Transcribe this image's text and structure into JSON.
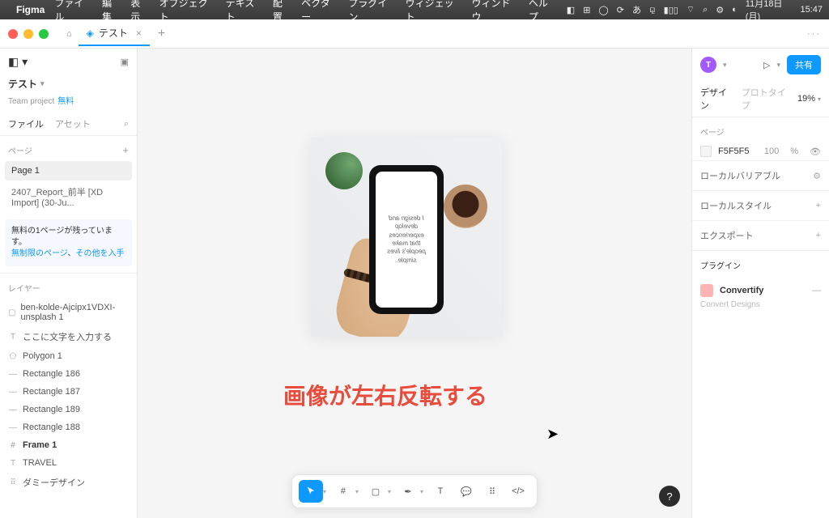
{
  "menubar": {
    "app": "Figma",
    "items": [
      "ファイル",
      "編集",
      "表示",
      "オブジェクト",
      "テキスト",
      "配置",
      "ベクター",
      "プラグイン",
      "ウィジェット",
      "ウィンドウ",
      "ヘルプ"
    ],
    "tray": {
      "ime": "あ",
      "date": "11月18日 (月)",
      "time": "15:47"
    }
  },
  "tabs": {
    "current": "テスト"
  },
  "left": {
    "title": "テスト",
    "subtitle": "Team project",
    "badge": "無料",
    "fileTab": "ファイル",
    "assetTab": "アセット",
    "pagesLabel": "ページ",
    "pages": [
      "Page 1",
      "2407_Report_前半  [XD Import] (30-Ju..."
    ],
    "noticeLine1": "無料の1ページが残っています。",
    "noticeLink1": "無制限のページ",
    "noticeComma": "、",
    "noticeLink2": "その他を入手",
    "layersLabel": "レイヤー",
    "layers": [
      {
        "icon": "▢",
        "name": "ben-kolde-Ajcipx1VDXI-unsplash 1"
      },
      {
        "icon": "T",
        "name": "ここに文字を入力する"
      },
      {
        "icon": "⬠",
        "name": "Polygon 1"
      },
      {
        "icon": "—",
        "name": "Rectangle 186"
      },
      {
        "icon": "—",
        "name": "Rectangle 187"
      },
      {
        "icon": "—",
        "name": "Rectangle 189"
      },
      {
        "icon": "—",
        "name": "Rectangle 188"
      },
      {
        "icon": "#",
        "name": "Frame 1",
        "bold": true
      },
      {
        "icon": "T",
        "name": "TRAVEL"
      },
      {
        "icon": "⠿",
        "name": "ダミーデザイン"
      }
    ]
  },
  "canvas": {
    "caption": "画像が左右反転する",
    "phoneLines": [
      "I design and",
      "develop",
      "experiences",
      "that make",
      "people's lives",
      "simple."
    ]
  },
  "right": {
    "avatar": "T",
    "share": "共有",
    "designTab": "デザイン",
    "protoTab": "プロトタイプ",
    "zoom": "19%",
    "pageLabel": "ページ",
    "bgHex": "F5F5F5",
    "bgPct": "100",
    "bgUnit": "%",
    "localVars": "ローカルバリアブル",
    "localStyles": "ローカルスタイル",
    "export": "エクスポート",
    "pluginsLabel": "プラグイン",
    "pluginName": "Convertify",
    "pluginDesc": "Convert Designs"
  }
}
